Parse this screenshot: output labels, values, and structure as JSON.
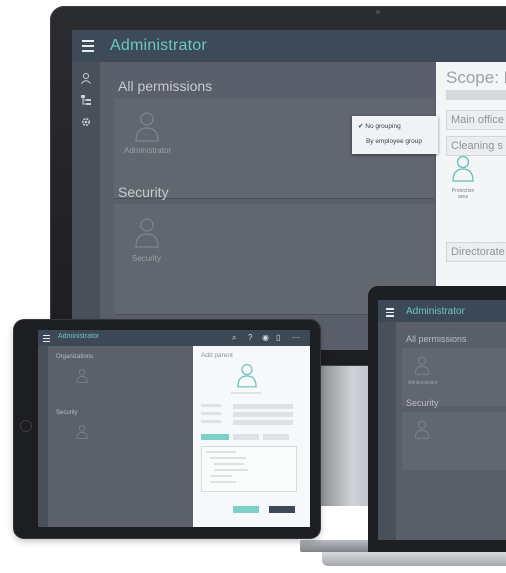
{
  "monitor": {
    "app_title": "Administrator",
    "rail_icons": [
      "user-icon",
      "hierarchy-icon",
      "gear-icon"
    ],
    "sections": [
      {
        "label": "All permissions",
        "avatar_caption": "Administrator"
      },
      {
        "label": "Security",
        "avatar_caption": "Security"
      }
    ],
    "dropdown": {
      "options": [
        "No grouping",
        "By employee group"
      ],
      "selected": "No grouping"
    },
    "side_panel": {
      "title": "Scope: E",
      "rows": [
        "Main office",
        "Cleaning s",
        "Directorate"
      ],
      "person_caption": "Protection area"
    }
  },
  "tablet": {
    "app_title": "Administrator",
    "sections": [
      "Organizations",
      "Security"
    ],
    "panel_title": "Add parent"
  },
  "laptop": {
    "app_title": "Administrator",
    "sections": [
      "All permissions",
      "Security"
    ],
    "avatar_caption": "Administrator"
  },
  "colors": {
    "accent": "#6cc7c1",
    "topbar": "#3d4a57",
    "canvas": "#545966"
  }
}
